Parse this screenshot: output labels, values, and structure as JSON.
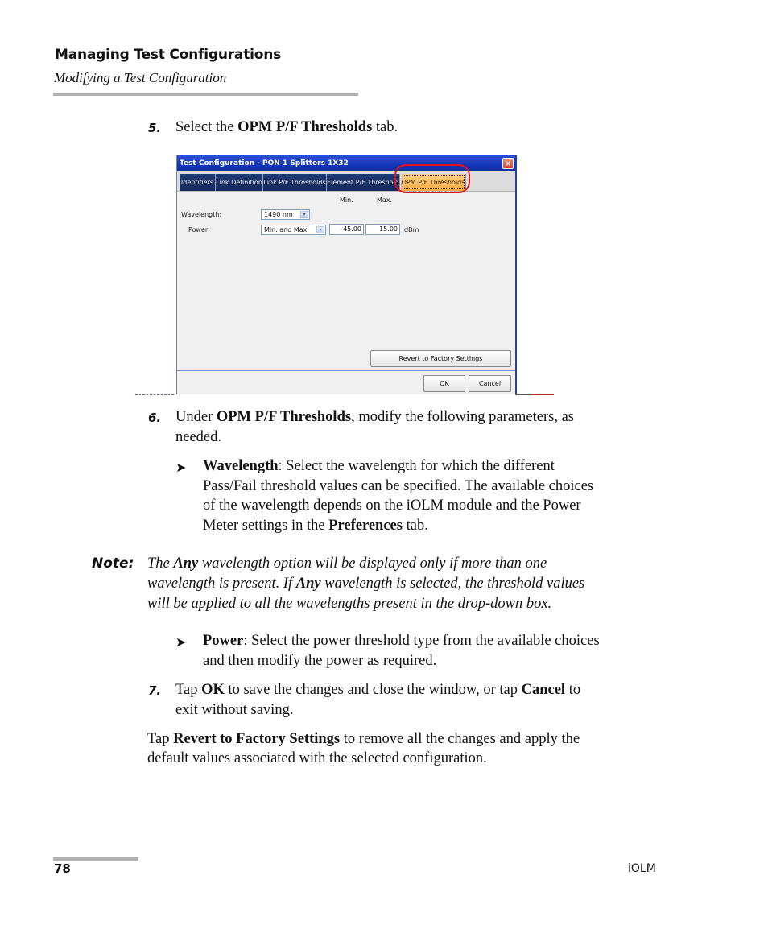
{
  "header": {
    "title": "Managing Test Configurations",
    "subtitle": "Modifying a Test Configuration"
  },
  "step5": {
    "number": "5.",
    "pre": "Select the ",
    "bold": "OPM P/F Thresholds",
    "post": " tab."
  },
  "dialog": {
    "title": "Test Configuration - PON 1 Splitters 1X32",
    "close_glyph": "✕",
    "tabs": [
      {
        "label": "Identifiers",
        "active": false
      },
      {
        "label": "Link Definition",
        "active": false
      },
      {
        "label": "Link P/F Thresholds",
        "active": false
      },
      {
        "label": "Element P/F Thresholds",
        "active": false
      },
      {
        "label": "OPM P/F Thresholds",
        "active": true
      }
    ],
    "col_min": "Min.",
    "col_max": "Max.",
    "wavelength_label": "Wavelength:",
    "wavelength_value": "1490 nm",
    "power_label": "Power:",
    "power_type_value": "Min. and Max.",
    "power_min": "-45.00",
    "power_max": "15.00",
    "power_unit": "dBm",
    "dropdown_arrow": "▾",
    "revert_button": "Revert to Factory Settings",
    "ok_button": "OK",
    "cancel_button": "Cancel",
    "highlight_color": "#e0121b"
  },
  "step6": {
    "number": "6.",
    "pre": "Under ",
    "bold": "OPM P/F Thresholds",
    "post": ", modify the following parameters, as",
    "line2": "needed."
  },
  "bullet_wavelength": {
    "glyph": "➤",
    "bold": "Wavelength",
    "line1": ": Select the wavelength for which the different",
    "line2": "Pass/Fail threshold values can be specified. The available choices",
    "line3": "of the wavelength depends on the iOLM module and the Power",
    "line4_pre": "Meter settings in the ",
    "line4_bold": "Preferences",
    "line4_post": " tab."
  },
  "note": {
    "label": "Note:",
    "l1_pre": "The ",
    "l1_bold": "Any",
    "l1_post": " wavelength option will be displayed only if more than one",
    "l2_pre": "wavelength is present. If ",
    "l2_bold": "Any",
    "l2_post": " wavelength is selected, the threshold values",
    "l3": "will be applied to all the wavelengths present in the drop-down box."
  },
  "bullet_power": {
    "glyph": "➤",
    "bold": "Power",
    "line1": ": Select the power threshold type from the available choices",
    "line2": "and then modify the power as required."
  },
  "step7": {
    "number": "7.",
    "pre": "Tap ",
    "bold1": "OK",
    "mid": " to save the changes and close the window, or tap ",
    "bold2": "Cancel",
    "post": " to",
    "line2": "exit without saving."
  },
  "revert_para": {
    "pre": "Tap ",
    "bold": "Revert to Factory Settings",
    "post": " to remove all the changes and apply the",
    "line2": "default values associated with the selected configuration."
  },
  "footer": {
    "page_number": "78",
    "doc_name": "iOLM"
  }
}
